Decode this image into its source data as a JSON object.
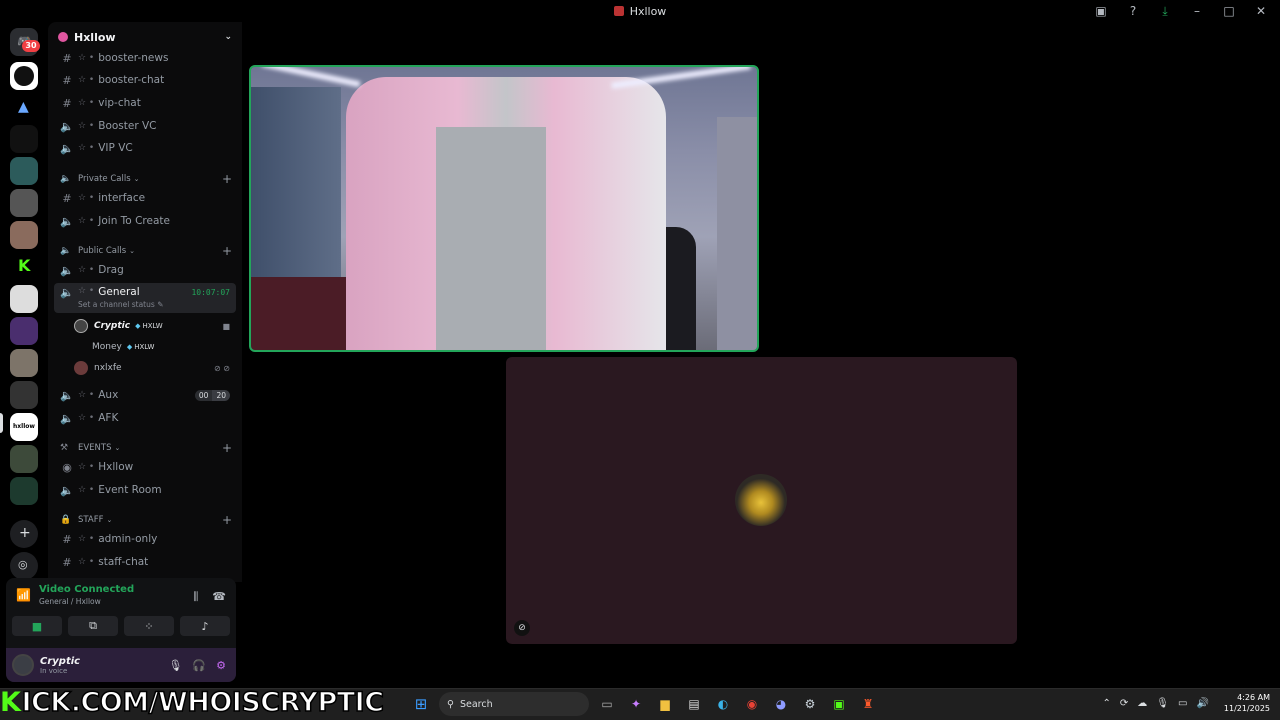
{
  "window": {
    "title": "Hxllow"
  },
  "rail": {
    "mentions_badge": "30"
  },
  "guild": {
    "name": "Hxllow"
  },
  "channels": {
    "booster_news": "booster-news",
    "booster_chat": "booster-chat",
    "vip_chat": "vip-chat",
    "booster_vc": "Booster VC",
    "vip_vc": "VIP VC",
    "private_calls": "Private Calls",
    "interface": "interface",
    "join_to_create": "Join To Create",
    "public_calls": "Public Calls",
    "drag": "Drag",
    "general": "General",
    "general_timer": "10:07:07",
    "general_status": "Set a channel status",
    "aux": "Aux",
    "aux_limit_a": "00",
    "aux_limit_b": "20",
    "afk": "AFK",
    "events": "EVENTS",
    "hxllow_stage": "Hxllow",
    "event_room": "Event Room",
    "staff": "STAFF",
    "admin_only": "admin-only",
    "staff_chat": "staff-chat"
  },
  "voice_users": [
    {
      "name": "Cryptic",
      "tag": "HXLW"
    },
    {
      "name": "Money",
      "tag": "HXLW"
    },
    {
      "name": "nxlxfe"
    }
  ],
  "voice_panel": {
    "status": "Video Connected",
    "location": "General / Hxllow"
  },
  "user": {
    "name": "Cryptic",
    "status": "In voice"
  },
  "overlay": {
    "kick_url": "ICK.COM/WHOISCRYPTIC",
    "k": "K"
  },
  "taskbar": {
    "search": "Search",
    "time": "4:26 AM",
    "date": "11/21/2025"
  },
  "colors": {
    "accent_green": "#23a55a",
    "user_tile_bg": "#2a1820",
    "kick_green": "#53fc18"
  }
}
